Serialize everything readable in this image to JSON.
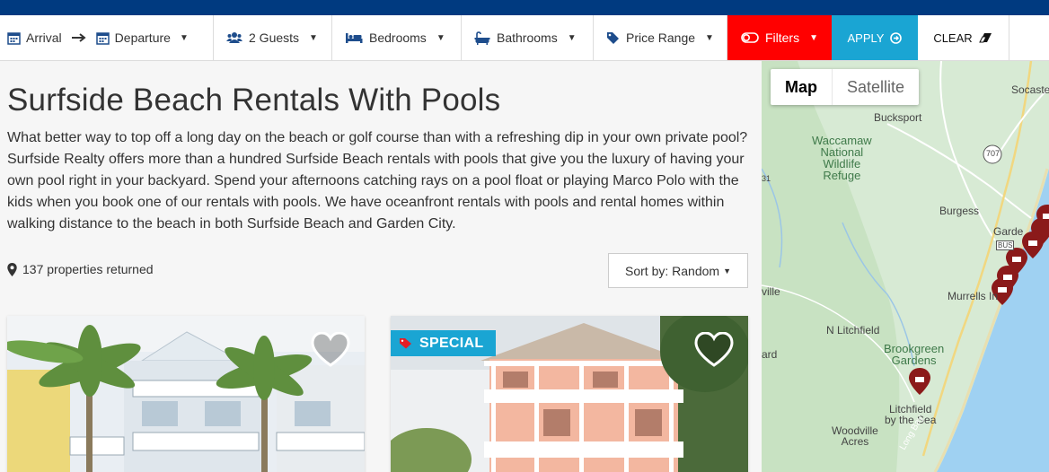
{
  "filters": {
    "arrival": "Arrival",
    "departure": "Departure",
    "guests": "2 Guests",
    "bedrooms": "Bedrooms",
    "bathrooms": "Bathrooms",
    "price": "Price Range",
    "filters": "Filters",
    "apply": "APPLY",
    "clear": "CLEAR"
  },
  "page": {
    "title": "Surfside Beach Rentals With Pools",
    "intro": "What better way to top off a long day on the beach or golf course than with a refreshing dip in your own private pool? Surfside Realty offers more than a hundred Surfside Beach rentals with pools that give you the luxury of having your own pool right in your backyard. Spend your afternoons catching rays on a pool float or playing Marco Polo with the kids when you book one of our rentals with pools. We have oceanfront rentals with pools and rental homes within walking distance to the beach in both Surfside Beach and Garden City.",
    "count": "137 properties returned",
    "sort": "Sort by: Random"
  },
  "cards": [
    {
      "badge": ""
    },
    {
      "badge": "SPECIAL"
    }
  ],
  "map": {
    "tab_map": "Map",
    "tab_satellite": "Satellite",
    "labels": {
      "socastee": "Socaste",
      "bucksport": "Bucksport",
      "waccamaw": "Waccamaw\nNational\nWildlife\nRefuge",
      "route707": "707",
      "route31": "31",
      "burgess": "Burgess",
      "garden": "Garde",
      "bus": "BUS",
      "ville": "ville",
      "murrells": "Murrells In",
      "nlitchfield": "N Litchfield",
      "ard": "ard",
      "brookgreen": "Brookgreen\nGardens",
      "litchfield": "Litchfield\nby the Sea",
      "woodville": "Woodville\nAcres",
      "longbay": "Long Bay"
    }
  },
  "colors": {
    "topbar": "#003a80",
    "filters_bg": "#ff0000",
    "accent": "#1aa5d3",
    "map_pin": "#8b1a1a",
    "ocean": "#9fd1f2",
    "land": "#d7ead4"
  }
}
